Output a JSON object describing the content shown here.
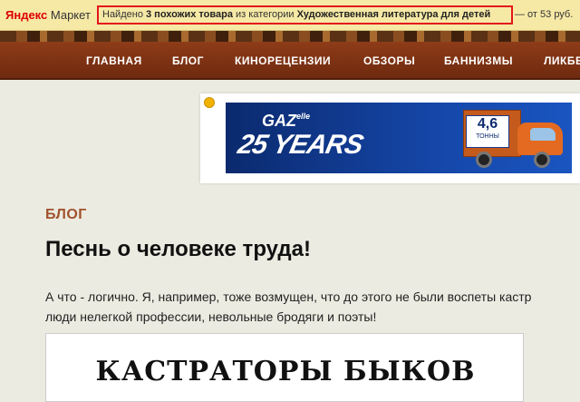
{
  "market_bar": {
    "logo_ya": "Яндекс",
    "logo_market": "Маркет",
    "found_prefix": "Найдено",
    "found_count": "3 похожих товара",
    "from_category": "из категории",
    "category": "Художественная литература для детей",
    "price": "— от 53 руб."
  },
  "nav": {
    "items": [
      "ГЛАВНАЯ",
      "БЛОГ",
      "КИНОРЕЦЕНЗИИ",
      "ОБЗОРЫ",
      "БАННИЗМЫ",
      "ЛИКБЕ"
    ]
  },
  "banner": {
    "brand": "GAZ",
    "brand_suffix": "elle",
    "years": "25 YEARS",
    "tonnage": "4,6",
    "tonnage_unit": "ТОННЫ"
  },
  "post": {
    "section": "БЛОГ",
    "title": "Песнь о человеке труда!",
    "line1": "А что - логично. Я, например, тоже возмущен, что до этого не были воспеты кастр",
    "line2": "люди нелегкой профессии, невольные бродяги и поэты!",
    "image_caption": "КАСТРАТОРЫ БЫКОВ"
  }
}
